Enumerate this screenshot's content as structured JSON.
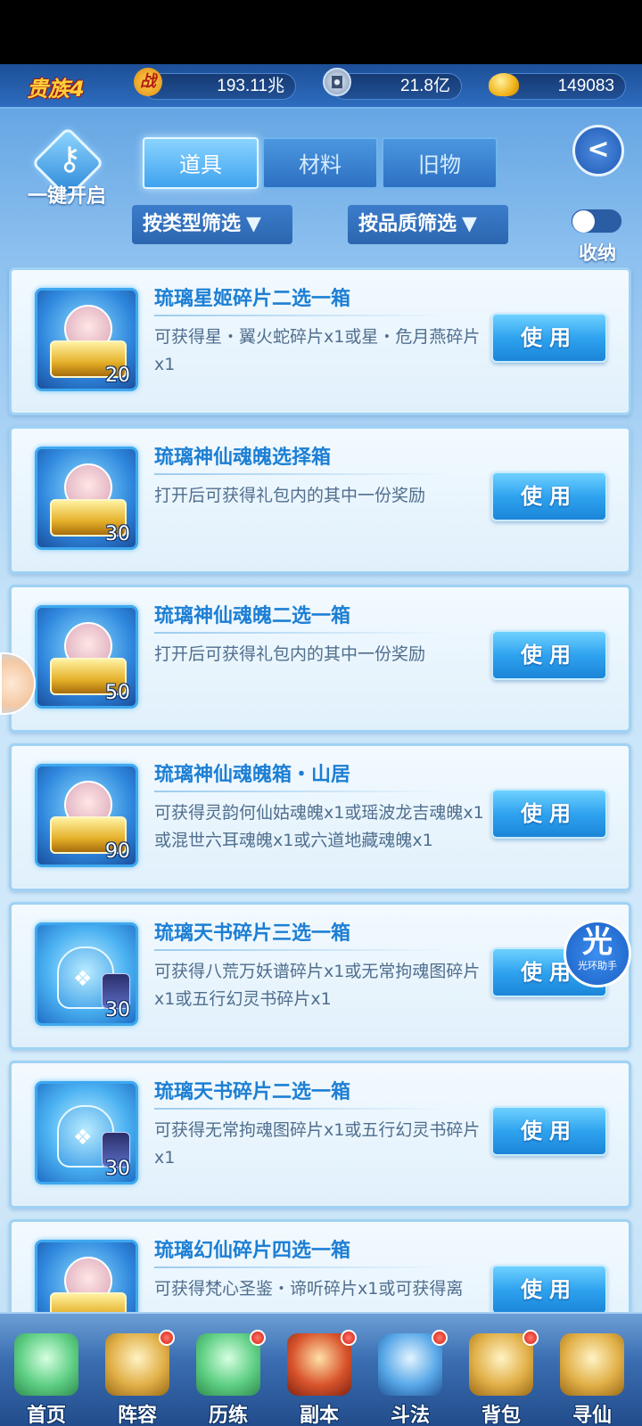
{
  "resources": {
    "rank": "贵族4",
    "battle_icon": "战",
    "battle_power": "193.11兆",
    "coin_icon": "coin-icon",
    "coins": "21.8亿",
    "gold_icon": "gold-ingot-icon",
    "gold": "149083"
  },
  "header": {
    "one_key_open": "一键开启",
    "tabs": [
      {
        "label": "道具",
        "active": true
      },
      {
        "label": "材料",
        "active": false
      },
      {
        "label": "旧物",
        "active": false
      }
    ],
    "back_icon": "<",
    "filter_type": "按类型筛选",
    "filter_quality": "按品质筛选",
    "fold_label": "收纳",
    "fold_toggle_on": false
  },
  "items": [
    {
      "title": "琉璃星姬碎片二选一箱",
      "desc": "可获得星・翼火蛇碎片x1或星・危月燕碎片x1",
      "qty": "20",
      "use_label": "使用",
      "icon": "chest-portrait-icon"
    },
    {
      "title": "琉璃神仙魂魄选择箱",
      "desc": "打开后可获得礼包内的其中一份奖励",
      "qty": "30",
      "use_label": "使用",
      "icon": "chest-portrait-icon"
    },
    {
      "title": "琉璃神仙魂魄二选一箱",
      "desc": "打开后可获得礼包内的其中一份奖励",
      "qty": "50",
      "use_label": "使用",
      "icon": "chest-portrait-icon"
    },
    {
      "title": "琉璃神仙魂魄箱・山居",
      "desc": "可获得灵韵何仙姑魂魄x1或瑶波龙吉魂魄x1或混世六耳魂魄x1或六道地藏魂魄x1",
      "qty": "90",
      "use_label": "使用",
      "icon": "chest-portrait-icon"
    },
    {
      "title": "琉璃天书碎片三选一箱",
      "desc": "可获得八荒万妖谱碎片x1或无常拘魂图碎片x1或五行幻灵书碎片x1",
      "qty": "30",
      "use_label": "使用",
      "icon": "scroll-bag-icon"
    },
    {
      "title": "琉璃天书碎片二选一箱",
      "desc": "可获得无常拘魂图碎片x1或五行幻灵书碎片x1",
      "qty": "30",
      "use_label": "使用",
      "icon": "scroll-bag-icon"
    },
    {
      "title": "琉璃幻仙碎片四选一箱",
      "desc": "可获得梵心圣鉴・谛听碎片x1或可获得离",
      "qty": "",
      "use_label": "使用",
      "icon": "chest-portrait-icon"
    }
  ],
  "helper": {
    "big": "光",
    "small": "光环助手"
  },
  "nav": [
    {
      "label": "首页",
      "badge": false
    },
    {
      "label": "阵容",
      "badge": true
    },
    {
      "label": "历练",
      "badge": true
    },
    {
      "label": "副本",
      "badge": true
    },
    {
      "label": "斗法",
      "badge": true
    },
    {
      "label": "背包",
      "badge": true
    },
    {
      "label": "寻仙",
      "badge": false
    }
  ]
}
